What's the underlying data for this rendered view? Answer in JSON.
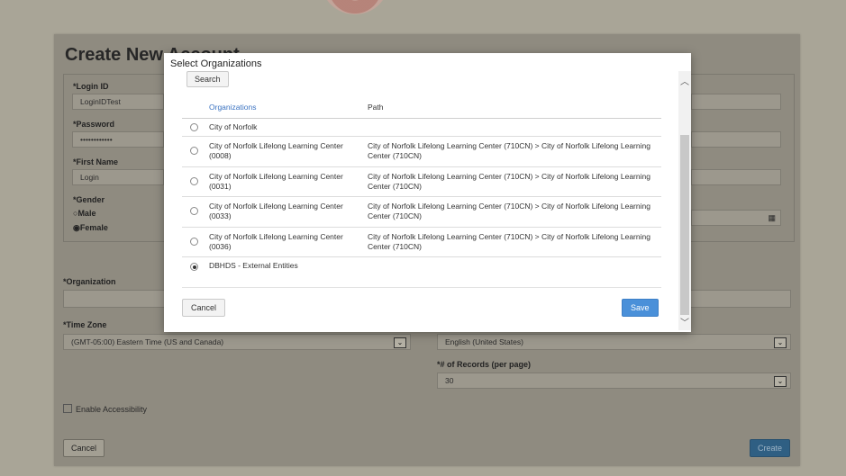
{
  "background": {
    "title": "Create New Account",
    "login_id": {
      "label": "*Login ID",
      "value": "LoginIDTest"
    },
    "password": {
      "label": "*Password",
      "value": "••••••••••••"
    },
    "first_name": {
      "label": "*First Name",
      "value": "Login"
    },
    "gender": {
      "label": "*Gender",
      "options": [
        "Male",
        "Female"
      ],
      "selected": "Female"
    },
    "organization": {
      "label": "*Organization",
      "value": ""
    },
    "time_zone": {
      "label": "*Time Zone",
      "value": "(GMT-05:00) Eastern Time (US and Canada)"
    },
    "language": {
      "value": "English (United States)"
    },
    "records": {
      "label": "*# of Records (per page)",
      "value": "30"
    },
    "accessibility_label": "Enable Accessibility",
    "cancel_label": "Cancel",
    "create_label": "Create"
  },
  "modal": {
    "title": "Select Organizations",
    "search_label": "Search",
    "columns": {
      "organizations": "Organizations",
      "path": "Path"
    },
    "rows": [
      {
        "org": "City of Norfolk",
        "path": "",
        "selected": false
      },
      {
        "org": "City of Norfolk Lifelong Learning Center (0008)",
        "path": "City of Norfolk Lifelong Learning Center (710CN) > City of Norfolk Lifelong Learning Center (710CN)",
        "selected": false
      },
      {
        "org": "City of Norfolk Lifelong Learning Center (0031)",
        "path": "City of Norfolk Lifelong Learning Center (710CN) > City of Norfolk Lifelong Learning Center (710CN)",
        "selected": false
      },
      {
        "org": "City of Norfolk Lifelong Learning Center (0033)",
        "path": "City of Norfolk Lifelong Learning Center (710CN) > City of Norfolk Lifelong Learning Center (710CN)",
        "selected": false
      },
      {
        "org": "City of Norfolk Lifelong Learning Center (0036)",
        "path": "City of Norfolk Lifelong Learning Center (710CN) > City of Norfolk Lifelong Learning Center (710CN)",
        "selected": false
      },
      {
        "org": "DBHDS - External Entities",
        "path": "",
        "selected": true
      }
    ],
    "cancel_label": "Cancel",
    "save_label": "Save"
  },
  "icons": {
    "select_arrow": "chevron-down-icon",
    "calendar": "calendar-icon",
    "scroll_up": "chevron-up-icon",
    "scroll_down": "chevron-down-icon"
  },
  "colors": {
    "primary": "#4a90d9",
    "overlay": "#8f8b80"
  }
}
